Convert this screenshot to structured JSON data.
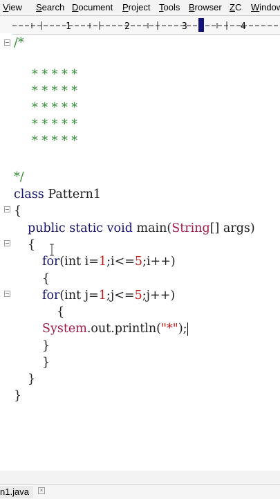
{
  "menu": {
    "items": [
      "View",
      "Search",
      "Document",
      "Project",
      "Tools",
      "Browser",
      "ZC",
      "Window"
    ]
  },
  "ruler": {
    "marks": [
      "1",
      "2",
      "3",
      "4"
    ]
  },
  "editor": {
    "comment_open": "/*",
    "pattern_rows": [
      "* * * * *",
      "* * * * *",
      "* * * * *",
      "* * * * *",
      "* * * * *"
    ],
    "comment_close": "*/",
    "class_kw": "class",
    "class_name": "Pattern1",
    "brace_open_class": "{",
    "method_kw": "public static void",
    "method_name": "main(",
    "method_param_type": "String",
    "method_param_rest": "[] args)",
    "brace_open_method": "{",
    "outer_for": {
      "kw": "for",
      "a": "(int i=",
      "n1": "1",
      "b": ";i<=",
      "n2": "5",
      "c": ";i++)"
    },
    "brace_open_outer": "{",
    "inner_for": {
      "kw": "for",
      "a": "(int j=",
      "n1": "1",
      "b": ";j<=",
      "n2": "5",
      "c": ";j++)"
    },
    "brace_open_inner": "{",
    "println": {
      "cls": "System",
      "rest": ".out.println(",
      "str": "\"*\"",
      "end": ");"
    },
    "brace_close_inner": "}",
    "brace_close_outer": "}",
    "brace_close_method": "}",
    "brace_close_class": "}"
  },
  "tabs": {
    "file_tab": "n1.java"
  }
}
